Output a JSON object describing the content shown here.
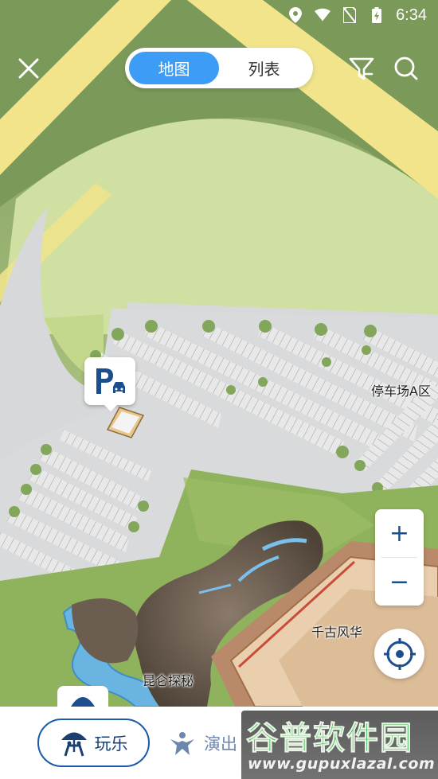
{
  "status_bar": {
    "time": "6:34",
    "icons": [
      "location-pin-icon",
      "wifi-icon",
      "no-sim-icon",
      "battery-charging-icon"
    ]
  },
  "top_bar": {
    "close_icon": "close-icon",
    "view_toggle": {
      "tabs": [
        "地图",
        "列表"
      ],
      "selected": "地图"
    },
    "filter_icon": "filter-icon",
    "search_icon": "search-icon"
  },
  "map": {
    "labels": {
      "parking_area": "停车场A区",
      "hall": "千古风华",
      "cave": "昆仑探秘"
    },
    "parking_marker_icon": "parking-car-icon"
  },
  "controls": {
    "zoom_in": "+",
    "zoom_out": "−",
    "locate_icon": "locate-crosshair-icon"
  },
  "bottom_bar": {
    "categories": [
      {
        "label": "玩乐",
        "icon": "umbrella-ride-icon",
        "selected": true
      },
      {
        "label": "演出",
        "icon": "performance-icon",
        "selected": false
      }
    ]
  },
  "watermark": {
    "title": "谷普软件园",
    "url": "www.gupuxlazal.com"
  },
  "colors": {
    "accent": "#3d9cf6",
    "navy": "#1b5aa8",
    "grass": "#8fb15e",
    "road": "#f1e48a"
  }
}
